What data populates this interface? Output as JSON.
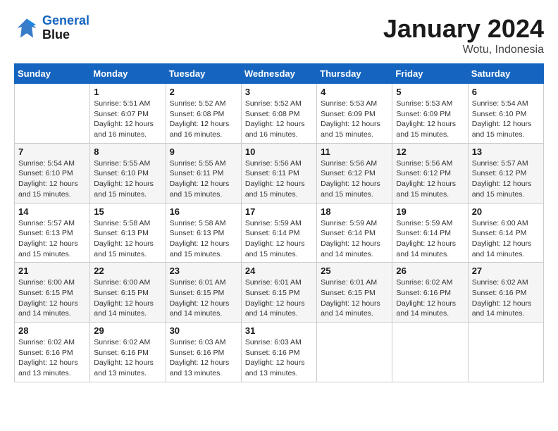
{
  "logo": {
    "line1": "General",
    "line2": "Blue"
  },
  "title": "January 2024",
  "location": "Wotu, Indonesia",
  "weekdays": [
    "Sunday",
    "Monday",
    "Tuesday",
    "Wednesday",
    "Thursday",
    "Friday",
    "Saturday"
  ],
  "weeks": [
    [
      {
        "day": "",
        "sunrise": "",
        "sunset": "",
        "daylight": ""
      },
      {
        "day": "1",
        "sunrise": "Sunrise: 5:51 AM",
        "sunset": "Sunset: 6:07 PM",
        "daylight": "Daylight: 12 hours and 16 minutes."
      },
      {
        "day": "2",
        "sunrise": "Sunrise: 5:52 AM",
        "sunset": "Sunset: 6:08 PM",
        "daylight": "Daylight: 12 hours and 16 minutes."
      },
      {
        "day": "3",
        "sunrise": "Sunrise: 5:52 AM",
        "sunset": "Sunset: 6:08 PM",
        "daylight": "Daylight: 12 hours and 16 minutes."
      },
      {
        "day": "4",
        "sunrise": "Sunrise: 5:53 AM",
        "sunset": "Sunset: 6:09 PM",
        "daylight": "Daylight: 12 hours and 15 minutes."
      },
      {
        "day": "5",
        "sunrise": "Sunrise: 5:53 AM",
        "sunset": "Sunset: 6:09 PM",
        "daylight": "Daylight: 12 hours and 15 minutes."
      },
      {
        "day": "6",
        "sunrise": "Sunrise: 5:54 AM",
        "sunset": "Sunset: 6:10 PM",
        "daylight": "Daylight: 12 hours and 15 minutes."
      }
    ],
    [
      {
        "day": "7",
        "sunrise": "Sunrise: 5:54 AM",
        "sunset": "Sunset: 6:10 PM",
        "daylight": "Daylight: 12 hours and 15 minutes."
      },
      {
        "day": "8",
        "sunrise": "Sunrise: 5:55 AM",
        "sunset": "Sunset: 6:10 PM",
        "daylight": "Daylight: 12 hours and 15 minutes."
      },
      {
        "day": "9",
        "sunrise": "Sunrise: 5:55 AM",
        "sunset": "Sunset: 6:11 PM",
        "daylight": "Daylight: 12 hours and 15 minutes."
      },
      {
        "day": "10",
        "sunrise": "Sunrise: 5:56 AM",
        "sunset": "Sunset: 6:11 PM",
        "daylight": "Daylight: 12 hours and 15 minutes."
      },
      {
        "day": "11",
        "sunrise": "Sunrise: 5:56 AM",
        "sunset": "Sunset: 6:12 PM",
        "daylight": "Daylight: 12 hours and 15 minutes."
      },
      {
        "day": "12",
        "sunrise": "Sunrise: 5:56 AM",
        "sunset": "Sunset: 6:12 PM",
        "daylight": "Daylight: 12 hours and 15 minutes."
      },
      {
        "day": "13",
        "sunrise": "Sunrise: 5:57 AM",
        "sunset": "Sunset: 6:12 PM",
        "daylight": "Daylight: 12 hours and 15 minutes."
      }
    ],
    [
      {
        "day": "14",
        "sunrise": "Sunrise: 5:57 AM",
        "sunset": "Sunset: 6:13 PM",
        "daylight": "Daylight: 12 hours and 15 minutes."
      },
      {
        "day": "15",
        "sunrise": "Sunrise: 5:58 AM",
        "sunset": "Sunset: 6:13 PM",
        "daylight": "Daylight: 12 hours and 15 minutes."
      },
      {
        "day": "16",
        "sunrise": "Sunrise: 5:58 AM",
        "sunset": "Sunset: 6:13 PM",
        "daylight": "Daylight: 12 hours and 15 minutes."
      },
      {
        "day": "17",
        "sunrise": "Sunrise: 5:59 AM",
        "sunset": "Sunset: 6:14 PM",
        "daylight": "Daylight: 12 hours and 15 minutes."
      },
      {
        "day": "18",
        "sunrise": "Sunrise: 5:59 AM",
        "sunset": "Sunset: 6:14 PM",
        "daylight": "Daylight: 12 hours and 14 minutes."
      },
      {
        "day": "19",
        "sunrise": "Sunrise: 5:59 AM",
        "sunset": "Sunset: 6:14 PM",
        "daylight": "Daylight: 12 hours and 14 minutes."
      },
      {
        "day": "20",
        "sunrise": "Sunrise: 6:00 AM",
        "sunset": "Sunset: 6:14 PM",
        "daylight": "Daylight: 12 hours and 14 minutes."
      }
    ],
    [
      {
        "day": "21",
        "sunrise": "Sunrise: 6:00 AM",
        "sunset": "Sunset: 6:15 PM",
        "daylight": "Daylight: 12 hours and 14 minutes."
      },
      {
        "day": "22",
        "sunrise": "Sunrise: 6:00 AM",
        "sunset": "Sunset: 6:15 PM",
        "daylight": "Daylight: 12 hours and 14 minutes."
      },
      {
        "day": "23",
        "sunrise": "Sunrise: 6:01 AM",
        "sunset": "Sunset: 6:15 PM",
        "daylight": "Daylight: 12 hours and 14 minutes."
      },
      {
        "day": "24",
        "sunrise": "Sunrise: 6:01 AM",
        "sunset": "Sunset: 6:15 PM",
        "daylight": "Daylight: 12 hours and 14 minutes."
      },
      {
        "day": "25",
        "sunrise": "Sunrise: 6:01 AM",
        "sunset": "Sunset: 6:15 PM",
        "daylight": "Daylight: 12 hours and 14 minutes."
      },
      {
        "day": "26",
        "sunrise": "Sunrise: 6:02 AM",
        "sunset": "Sunset: 6:16 PM",
        "daylight": "Daylight: 12 hours and 14 minutes."
      },
      {
        "day": "27",
        "sunrise": "Sunrise: 6:02 AM",
        "sunset": "Sunset: 6:16 PM",
        "daylight": "Daylight: 12 hours and 14 minutes."
      }
    ],
    [
      {
        "day": "28",
        "sunrise": "Sunrise: 6:02 AM",
        "sunset": "Sunset: 6:16 PM",
        "daylight": "Daylight: 12 hours and 13 minutes."
      },
      {
        "day": "29",
        "sunrise": "Sunrise: 6:02 AM",
        "sunset": "Sunset: 6:16 PM",
        "daylight": "Daylight: 12 hours and 13 minutes."
      },
      {
        "day": "30",
        "sunrise": "Sunrise: 6:03 AM",
        "sunset": "Sunset: 6:16 PM",
        "daylight": "Daylight: 12 hours and 13 minutes."
      },
      {
        "day": "31",
        "sunrise": "Sunrise: 6:03 AM",
        "sunset": "Sunset: 6:16 PM",
        "daylight": "Daylight: 12 hours and 13 minutes."
      },
      {
        "day": "",
        "sunrise": "",
        "sunset": "",
        "daylight": ""
      },
      {
        "day": "",
        "sunrise": "",
        "sunset": "",
        "daylight": ""
      },
      {
        "day": "",
        "sunrise": "",
        "sunset": "",
        "daylight": ""
      }
    ]
  ]
}
